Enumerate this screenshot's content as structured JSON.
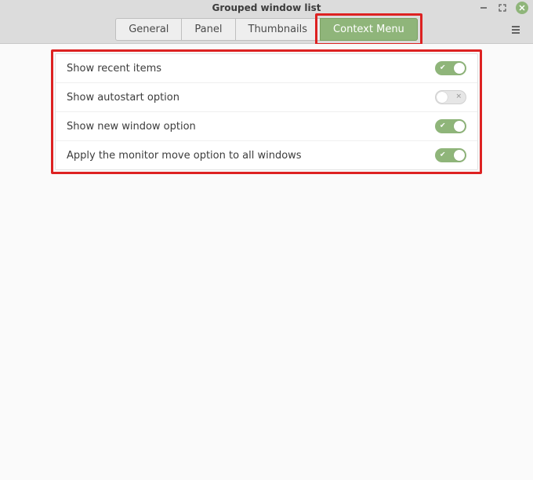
{
  "window": {
    "title": "Grouped window list"
  },
  "tabs": {
    "general": "General",
    "panel": "Panel",
    "thumbnails": "Thumbnails",
    "context_menu": "Context Menu"
  },
  "settings": {
    "show_recent_items": {
      "label": "Show recent items",
      "value": true
    },
    "show_autostart_option": {
      "label": "Show autostart option",
      "value": false
    },
    "show_new_window_option": {
      "label": "Show new window option",
      "value": true
    },
    "apply_monitor_move_all": {
      "label": "Apply the monitor move option to all windows",
      "value": true
    }
  },
  "highlight": {
    "tab": "context_menu",
    "panel": true
  }
}
